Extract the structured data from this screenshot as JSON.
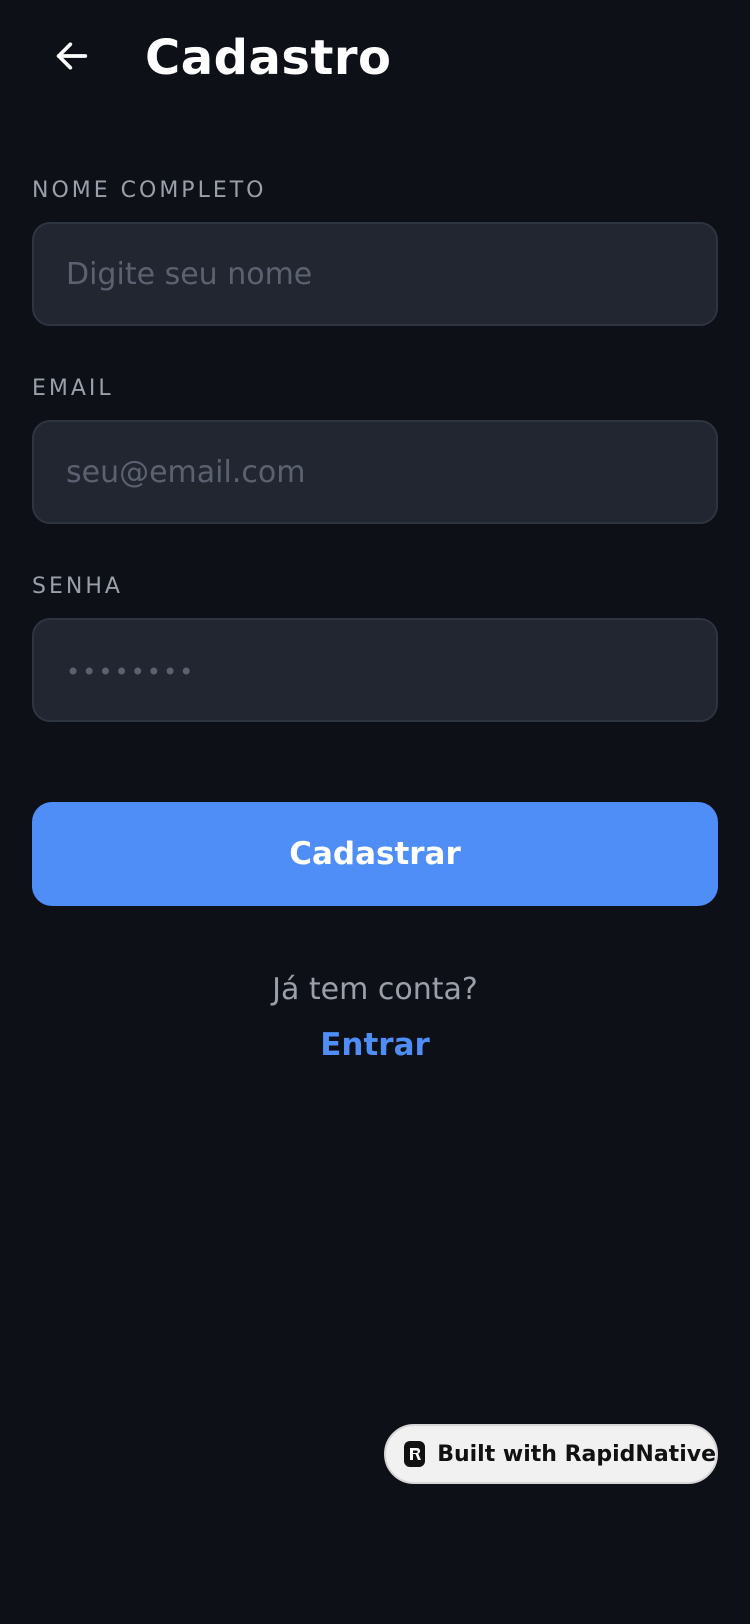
{
  "header": {
    "back_icon": "arrow-left-icon",
    "title": "Cadastro"
  },
  "form": {
    "name": {
      "label": "NOME COMPLETO",
      "placeholder": "Digite seu nome",
      "value": ""
    },
    "email": {
      "label": "EMAIL",
      "placeholder": "seu@email.com",
      "value": ""
    },
    "password": {
      "label": "SENHA",
      "placeholder": "••••••••",
      "value": ""
    },
    "submit_label": "Cadastrar"
  },
  "footer": {
    "prompt": "Já tem conta?",
    "login_label": "Entrar"
  },
  "badge": {
    "icon": "rapidnative-logo-icon",
    "text": "Built with RapidNative"
  },
  "colors": {
    "background": "#0d1017",
    "accent": "#4f8ef7",
    "input_bg": "#212630",
    "label": "#9aa0aa"
  }
}
